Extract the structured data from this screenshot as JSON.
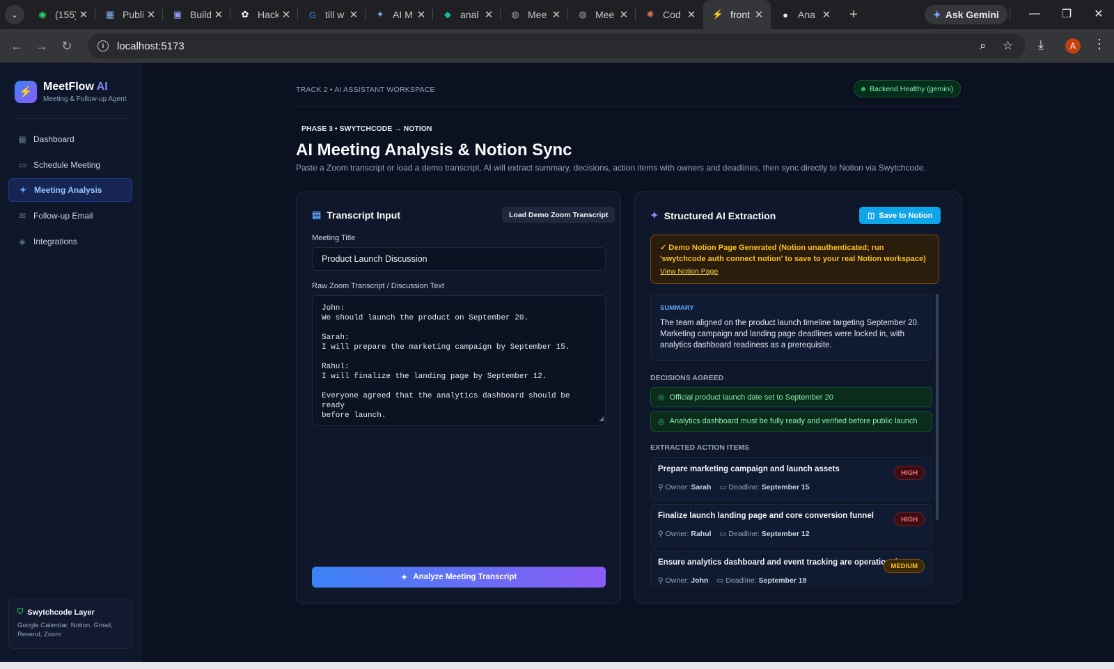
{
  "browser": {
    "tabs": [
      {
        "title": "(155)",
        "icon": "whatsapp-icon",
        "glyph": "◉",
        "color": "#25d366"
      },
      {
        "title": "Publi",
        "icon": "grid-dots-icon",
        "glyph": "▦",
        "color": "#8ab4f8"
      },
      {
        "title": "Build",
        "icon": "build-app-icon",
        "glyph": "▣",
        "color": "#8b9cf7"
      },
      {
        "title": "Hack",
        "icon": "openai-icon",
        "glyph": "✿",
        "color": "#ffffff"
      },
      {
        "title": "till w",
        "icon": "google-icon",
        "glyph": "G",
        "color": "#4285f4"
      },
      {
        "title": "AI M",
        "icon": "gemini-sparkle-icon",
        "glyph": "✦",
        "color": "#7aa7ff"
      },
      {
        "title": "anal",
        "icon": "diamond-icon",
        "glyph": "◆",
        "color": "#14b8a6"
      },
      {
        "title": "Mee",
        "icon": "globe-icon",
        "glyph": "◍",
        "color": "#9aa0a6"
      },
      {
        "title": "Mee",
        "icon": "globe-icon",
        "glyph": "◍",
        "color": "#9aa0a6"
      },
      {
        "title": "Cod",
        "icon": "claude-icon",
        "glyph": "✺",
        "color": "#d97757"
      },
      {
        "title": "front",
        "icon": "vite-icon",
        "glyph": "⚡",
        "color": "#a78bfa"
      },
      {
        "title": "Ana",
        "icon": "github-icon",
        "glyph": "●",
        "color": "#e8eaed"
      }
    ],
    "active_tab": 10,
    "ask_gemini": "Ask Gemini",
    "url": "localhost:5173",
    "profile_initial": "A"
  },
  "sidebar": {
    "brand_name": "MeetFlow",
    "brand_ai": "AI",
    "brand_sub": "Meeting & Follow-up Agent",
    "items": [
      {
        "label": "Dashboard",
        "icon": "grid-icon"
      },
      {
        "label": "Schedule Meeting",
        "icon": "calendar-icon"
      },
      {
        "label": "Meeting Analysis",
        "icon": "sparkles-icon"
      },
      {
        "label": "Follow-up Email",
        "icon": "mail-icon"
      },
      {
        "label": "Integrations",
        "icon": "layers-icon"
      }
    ],
    "active_item": 2,
    "layer_title": "Swytchcode Layer",
    "layer_sub": "Google Calendar, Notion, Gmail, Resend, Zoom"
  },
  "header": {
    "breadcrumb": "TRACK 2 • AI ASSISTANT WORKSPACE",
    "health": "Backend Healthy (gemini)",
    "phase": "PHASE 3 • SWYTCHCODE → NOTION",
    "title": "AI Meeting Analysis & Notion Sync",
    "lead": "Paste a Zoom transcript or load a demo transcript. AI will extract summary, decisions, action items with owners and deadlines, then sync directly to Notion via Swytchcode."
  },
  "transcript": {
    "title": "Transcript Input",
    "demo_button": "Load Demo Zoom Transcript",
    "meeting_title_label": "Meeting Title",
    "meeting_title_value": "Product Launch Discussion",
    "raw_label": "Raw Zoom Transcript / Discussion Text",
    "raw_text": "John:\nWe should launch the product on September 20.\n\nSarah:\nI will prepare the marketing campaign by September 15.\n\nRahul:\nI will finalize the landing page by September 12.\n\nEveryone agreed that the analytics dashboard should be ready\nbefore launch.",
    "analyze_button": "Analyze Meeting Transcript"
  },
  "extraction": {
    "title": "Structured AI Extraction",
    "save_button": "Save to Notion",
    "notice": "✓ Demo Notion Page Generated (Notion unauthenticated; run 'swytchcode auth connect notion' to save to your real Notion workspace)",
    "notice_link": "View Notion Page",
    "summary_heading": "SUMMARY",
    "summary": "The team aligned on the product launch timeline targeting September 20. Marketing campaign and landing page deadlines were locked in, with analytics dashboard readiness as a prerequisite.",
    "decisions_heading": "DECISIONS AGREED",
    "decisions": [
      "Official product launch date set to September 20",
      "Analytics dashboard must be fully ready and verified before public launch"
    ],
    "actions_heading": "EXTRACTED ACTION ITEMS",
    "owner_label": "Owner:",
    "deadline_label": "Deadline:",
    "actions": [
      {
        "task": "Prepare marketing campaign and launch assets",
        "owner": "Sarah",
        "deadline": "September 15",
        "priority": "HIGH"
      },
      {
        "task": "Finalize launch landing page and core conversion funnel",
        "owner": "Rahul",
        "deadline": "September 12",
        "priority": "HIGH"
      },
      {
        "task": "Ensure analytics dashboard and event tracking are operational",
        "owner": "John",
        "deadline": "September 18",
        "priority": "MEDIUM"
      }
    ]
  }
}
